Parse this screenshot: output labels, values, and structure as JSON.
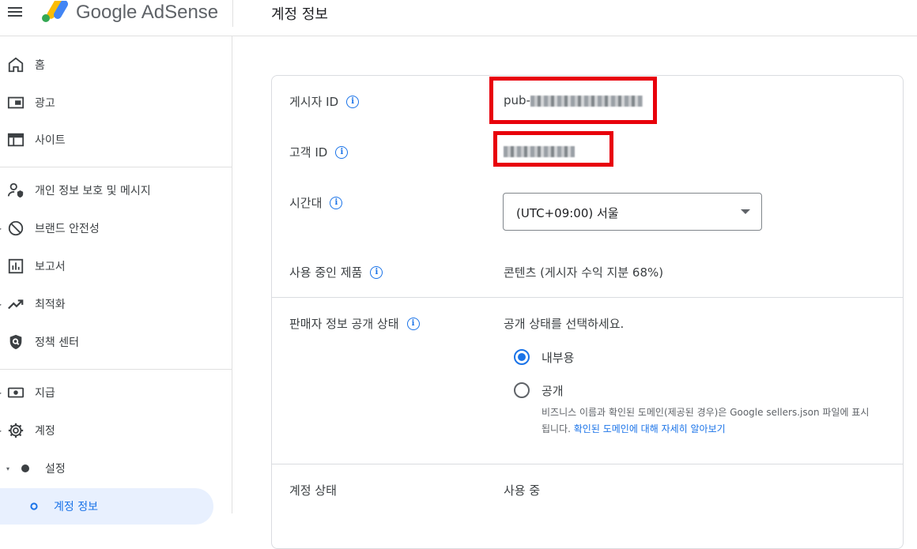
{
  "header": {
    "app_name": "Google AdSense",
    "page_title": "계정 정보"
  },
  "sidebar": {
    "items": [
      {
        "label": "홈",
        "icon": "home-icon"
      },
      {
        "label": "광고",
        "icon": "ads-icon"
      },
      {
        "label": "사이트",
        "icon": "sites-icon"
      },
      {
        "label": "개인 정보 보호 및 메시지",
        "icon": "privacy-person-icon"
      },
      {
        "label": "브랜드 안전성",
        "icon": "block-icon"
      },
      {
        "label": "보고서",
        "icon": "reports-icon"
      },
      {
        "label": "최적화",
        "icon": "trending-up-icon"
      },
      {
        "label": "정책 센터",
        "icon": "policy-shield-icon"
      },
      {
        "label": "지급",
        "icon": "payments-icon"
      },
      {
        "label": "계정",
        "icon": "gear-icon"
      },
      {
        "label": "설정",
        "icon": "dot-icon"
      },
      {
        "label": "계정 정보",
        "icon": "circle-icon"
      }
    ]
  },
  "account": {
    "publisher_id_label": "게시자 ID",
    "publisher_id_prefix": "pub-",
    "customer_id_label": "고객 ID",
    "timezone_label": "시간대",
    "timezone_value": "(UTC+09:00) 서울",
    "product_label": "사용 중인 제품",
    "product_value": "콘텐츠 (게시자 수익 지분 68%)",
    "seller_visibility_label": "판매자 정보 공개 상태",
    "seller_visibility_prompt": "공개 상태를 선택하세요.",
    "option_internal": "내부용",
    "option_public": "공개",
    "public_help_text": "비즈니스 이름과 확인된 도메인(제공된 경우)은 Google sellers.json 파일에 표시됩니다.",
    "public_help_link": "확인된 도메인에 대해 자세히 알아보기",
    "status_label": "계정 상태",
    "status_value": "사용 중"
  },
  "colors": {
    "accent": "#1a73e8",
    "highlight_box": "#e8000b",
    "active_nav_bg": "#e8f0fe"
  }
}
